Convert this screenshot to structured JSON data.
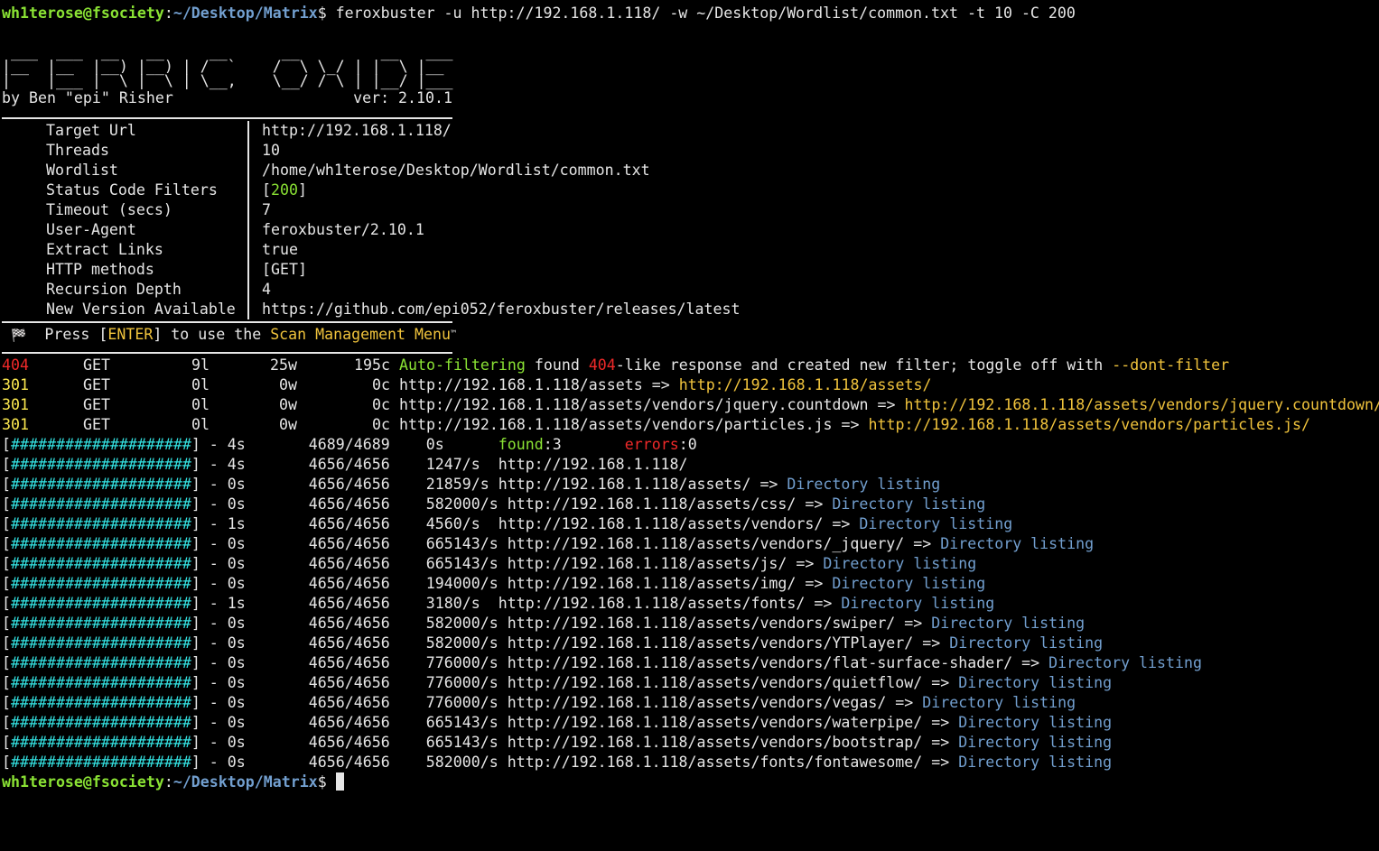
{
  "prompt": {
    "user_host": "wh1terose@fsociety",
    "colon": ":",
    "path": "~/Desktop/Matrix",
    "symbol": "$",
    "command": " feroxbuster -u http://192.168.1.118/ -w ~/Desktop/Wordlist/common.txt -t 10 -C 200"
  },
  "banner": {
    "art": " ___  ___  __   __     __      __         __   ___\n|__  |__  |__) |__) | /  `    /  \\ \\_/ | |  \\ |__\n|    |___ |  \\ |  \\ | \\__,    \\__/ / \\ | |__/ |___",
    "author": "by Ben \"epi\" Risher",
    "version": "ver: 2.10.1"
  },
  "config": [
    {
      "key": "Target Url",
      "value": "http://192.168.1.118/"
    },
    {
      "key": "Threads",
      "value": "10"
    },
    {
      "key": "Wordlist",
      "value": "/home/wh1terose/Desktop/Wordlist/common.txt"
    },
    {
      "key": "Status Code Filters",
      "value_prefix": "[",
      "value_highlight": "200",
      "value_suffix": "]"
    },
    {
      "key": "Timeout (secs)",
      "value": "7"
    },
    {
      "key": "User-Agent",
      "value": "feroxbuster/2.10.1"
    },
    {
      "key": "Extract Links",
      "value": "true"
    },
    {
      "key": "HTTP methods",
      "value": "[GET]"
    },
    {
      "key": "Recursion Depth",
      "value": "4"
    },
    {
      "key": "New Version Available",
      "value": "https://github.com/epi052/feroxbuster/releases/latest"
    }
  ],
  "menu_hint": {
    "icon": "🏁",
    "t1": "Press [",
    "enter": "ENTER",
    "t2": "] to use the ",
    "menu": "Scan Management Menu",
    "tm": "™"
  },
  "responses": [
    {
      "code": "404",
      "method": "GET",
      "lines": "9l",
      "words": "25w",
      "chars": "195c",
      "pre": "Auto-filtering",
      "mid1": " found ",
      "code2": "404",
      "mid2": "-like response and created new filter; toggle off with ",
      "flag": "--dont-filter"
    },
    {
      "code": "301",
      "method": "GET",
      "lines": "0l",
      "words": "0w",
      "chars": "0c",
      "url": "http://192.168.1.118/assets",
      "target": "http://192.168.1.118/assets/"
    },
    {
      "code": "301",
      "method": "GET",
      "lines": "0l",
      "words": "0w",
      "chars": "0c",
      "url": "http://192.168.1.118/assets/vendors/jquery.countdown",
      "target": "http://192.168.1.118/assets/vendors/jquery.countdown/"
    },
    {
      "code": "301",
      "method": "GET",
      "lines": "0l",
      "words": "0w",
      "chars": "0c",
      "url": "http://192.168.1.118/assets/vendors/particles.js",
      "target": "http://192.168.1.118/assets/vendors/particles.js/"
    }
  ],
  "progress_summary": {
    "bar": "####################",
    "time": "4s",
    "count": "4689/4689",
    "rate": "0s",
    "found_label": "found",
    "found": "3",
    "errors_label": "errors",
    "errors": "0"
  },
  "progress": [
    {
      "bar": "####################",
      "time": "4s",
      "count": "4656/4656",
      "rate": "1247/s",
      "url": "http://192.168.1.118/",
      "note": ""
    },
    {
      "bar": "####################",
      "time": "0s",
      "count": "4656/4656",
      "rate": "21859/s",
      "url": "http://192.168.1.118/assets/",
      "note": "Directory listing"
    },
    {
      "bar": "####################",
      "time": "0s",
      "count": "4656/4656",
      "rate": "582000/s",
      "url": "http://192.168.1.118/assets/css/",
      "note": "Directory listing"
    },
    {
      "bar": "####################",
      "time": "1s",
      "count": "4656/4656",
      "rate": "4560/s",
      "url": "http://192.168.1.118/assets/vendors/",
      "note": "Directory listing"
    },
    {
      "bar": "####################",
      "time": "0s",
      "count": "4656/4656",
      "rate": "665143/s",
      "url": "http://192.168.1.118/assets/vendors/_jquery/",
      "note": "Directory listing"
    },
    {
      "bar": "####################",
      "time": "0s",
      "count": "4656/4656",
      "rate": "665143/s",
      "url": "http://192.168.1.118/assets/js/",
      "note": "Directory listing"
    },
    {
      "bar": "####################",
      "time": "0s",
      "count": "4656/4656",
      "rate": "194000/s",
      "url": "http://192.168.1.118/assets/img/",
      "note": "Directory listing"
    },
    {
      "bar": "####################",
      "time": "1s",
      "count": "4656/4656",
      "rate": "3180/s",
      "url": "http://192.168.1.118/assets/fonts/",
      "note": "Directory listing"
    },
    {
      "bar": "####################",
      "time": "0s",
      "count": "4656/4656",
      "rate": "582000/s",
      "url": "http://192.168.1.118/assets/vendors/swiper/",
      "note": "Directory listing"
    },
    {
      "bar": "####################",
      "time": "0s",
      "count": "4656/4656",
      "rate": "582000/s",
      "url": "http://192.168.1.118/assets/vendors/YTPlayer/",
      "note": "Directory listing"
    },
    {
      "bar": "####################",
      "time": "0s",
      "count": "4656/4656",
      "rate": "776000/s",
      "url": "http://192.168.1.118/assets/vendors/flat-surface-shader/",
      "note": "Directory listing"
    },
    {
      "bar": "####################",
      "time": "0s",
      "count": "4656/4656",
      "rate": "776000/s",
      "url": "http://192.168.1.118/assets/vendors/quietflow/",
      "note": "Directory listing"
    },
    {
      "bar": "####################",
      "time": "0s",
      "count": "4656/4656",
      "rate": "776000/s",
      "url": "http://192.168.1.118/assets/vendors/vegas/",
      "note": "Directory listing"
    },
    {
      "bar": "####################",
      "time": "0s",
      "count": "4656/4656",
      "rate": "665143/s",
      "url": "http://192.168.1.118/assets/vendors/waterpipe/",
      "note": "Directory listing"
    },
    {
      "bar": "####################",
      "time": "0s",
      "count": "4656/4656",
      "rate": "665143/s",
      "url": "http://192.168.1.118/assets/vendors/bootstrap/",
      "note": "Directory listing"
    },
    {
      "bar": "####################",
      "time": "0s",
      "count": "4656/4656",
      "rate": "582000/s",
      "url": "http://192.168.1.118/assets/fonts/fontawesome/",
      "note": "Directory listing"
    }
  ],
  "final_prompt": {
    "user_host": "wh1terose@fsociety",
    "colon": ":",
    "path": "~/Desktop/Matrix",
    "symbol": "$"
  },
  "colors": {
    "prompt_user": "#8ae234",
    "prompt_path": "#729fcf",
    "code_404": "#ef2929",
    "code_301": "#fce94f",
    "bar": "#34e2e2",
    "link": "#729fcf"
  }
}
